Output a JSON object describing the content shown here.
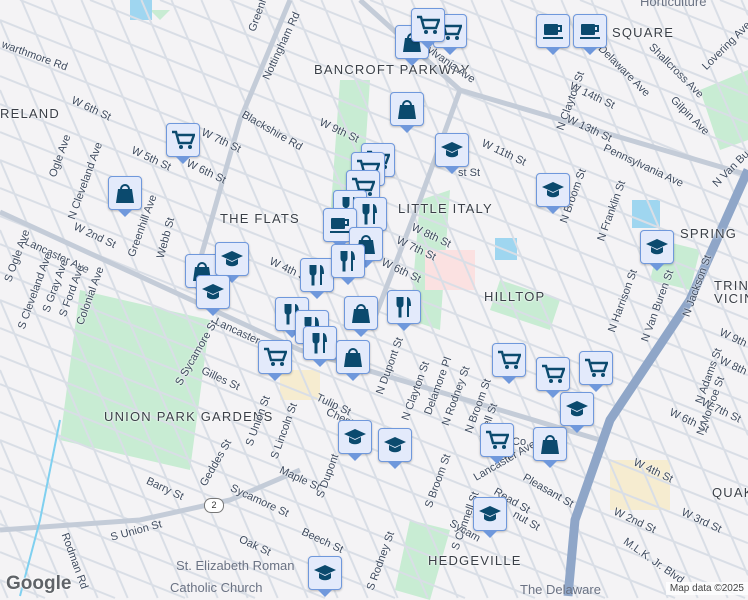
{
  "map": {
    "neighborhoods": [
      "BANCROFT PARKWAY",
      "THE FLATS",
      "LITTLE ITALY",
      "HILLTOP",
      "UNION PARK GARDENS",
      "HEDGEVILLE",
      "SQUARE",
      "RELAND",
      "SPRING",
      "TRINI",
      "VICIN",
      "QUAK"
    ],
    "streets": [
      "warthmore Rd",
      "W 6th St",
      "Greenh",
      "Nottingham Rd",
      "Pennsylvania Ave",
      "Blackshire Rd",
      "W 7th St",
      "W 6th St",
      "W 9th St",
      "Ogle Ave",
      "N Cleveland Ave",
      "W 5th St",
      "W 2nd St",
      "Greenhill Ave",
      "Webb St",
      "Lancaster Ave",
      "S Ogle Ave",
      "S Cleveland Ave",
      "S Gray Ave",
      "S Ford Ave",
      "Colonial Ave",
      "W 4th St",
      "Lancaster Ave",
      "S Sycamore St",
      "Gilles St",
      "S Union St",
      "S Lincoln St",
      "Tulip St",
      "Chestn",
      "Geddes St",
      "Barry St",
      "Maple St",
      "Sycamore St",
      "S Union St",
      "Beech St",
      "Oak St",
      "Rodman Rd",
      "S Dupont",
      "S Rodney St",
      "S Broom St",
      "S Connell St",
      "S Fra",
      "Lancaster Ave",
      "Pleasant St",
      "Read St",
      "nut St",
      "N Dupont St",
      "N Clayton St",
      "Delamore Pl",
      "N Rodney St",
      "N Broom St",
      "nnell St",
      "W 8th St",
      "W 7th St",
      "W 6th St",
      "W 11th St",
      "st St",
      "N Clayton St",
      "W 14th St",
      "W 13th St",
      "Delaware Ave",
      "Shallcross Ave",
      "Gilpin Ave",
      "Lovering Ave",
      "Pennsylvania Ave",
      "N Van Bu",
      "N Broom St",
      "N Franklin St",
      "N Harrison St",
      "N Van Buren St",
      "N Jackson St",
      "N Adams St",
      "N Monroe St",
      "W 9th St",
      "W 8th St",
      "W 7th St",
      "W 6th St",
      "W 4th St",
      "W 2nd St",
      "W 3rd St",
      "M.L.K. Jr. Blvd",
      "Sycam",
      "Co"
    ],
    "pois": [
      "St. Elizabeth Roman",
      "Catholic Church",
      "The Delaware",
      "Horticulture"
    ],
    "route_shield": "2",
    "markers": [
      "cart",
      "shop",
      "shop",
      "cart",
      "cart",
      "cup",
      "cup",
      "shop",
      "school",
      "cart",
      "cart",
      "cart",
      "food",
      "food",
      "cup",
      "shop",
      "food",
      "food",
      "shop",
      "school",
      "school",
      "food",
      "food",
      "food",
      "shop",
      "food",
      "shop",
      "cart",
      "school",
      "school",
      "cart",
      "cart",
      "cart",
      "school",
      "shop",
      "cart",
      "school",
      "school",
      "school",
      "school"
    ],
    "logo": "Google",
    "attribution": "Map data ©2025",
    "colors": {
      "marker_bg": "#e3eafb",
      "marker_border": "#6f98dc",
      "marker_icon": "#0b4a6e",
      "park": "#c8ecd3",
      "highway": "#8fa6c8"
    }
  }
}
